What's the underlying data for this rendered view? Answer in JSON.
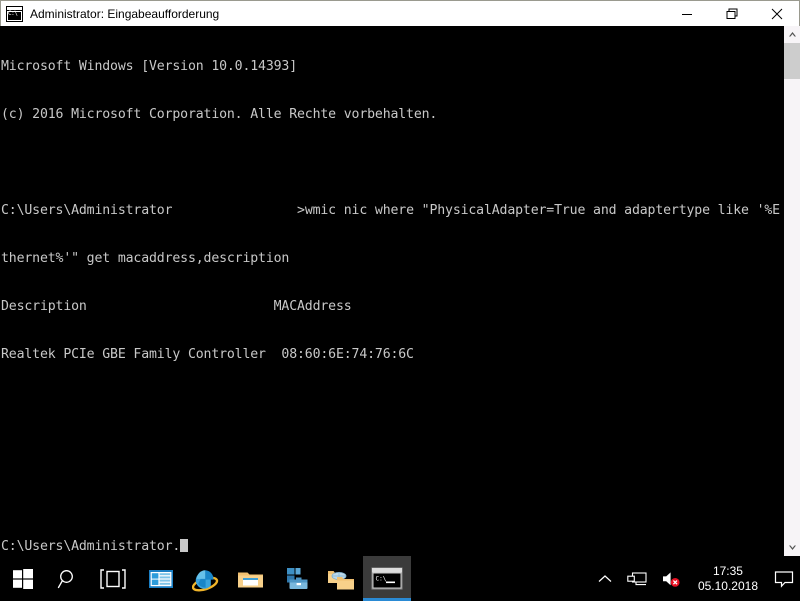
{
  "window": {
    "title": "Administrator: Eingabeaufforderung",
    "icon": "cmd-icon",
    "icon_text": "C:\\",
    "controls": {
      "minimize_label": "Minimieren",
      "restore_label": "Wiederherstellen",
      "close_label": "Schließen"
    }
  },
  "console": {
    "background": "#000000",
    "foreground": "#c8c8c8",
    "lines": [
      "Microsoft Windows [Version 10.0.14393]",
      "(c) 2016 Microsoft Corporation. Alle Rechte vorbehalten.",
      "",
      "",
      "Description                        MACAddress",
      "Realtek PCIe GBE Family Controller  08:60:6E:74:76:6C",
      "",
      "",
      ""
    ],
    "prompt_line": {
      "path": "C:\\Users\\Administrator",
      "redacted": "                ",
      "chevron": ">",
      "command": "wmic nic where \"PhysicalAdapter=True and adaptertype like '%E"
    },
    "command_wrap": "thernet%'\" get macaddress,description",
    "final_prompt": {
      "path": "C:\\Users\\Administrator.",
      "cursor": "_"
    }
  },
  "scrollbar": {
    "up_arrow": "scroll-up-arrow",
    "down_arrow": "scroll-down-arrow",
    "thumb_position_percent": 0
  },
  "taskbar": {
    "start": {
      "label": "Start",
      "icon": "windows-logo-icon"
    },
    "search": {
      "label": "Suchen",
      "icon": "search-icon"
    },
    "taskview": {
      "label": "Taskansicht",
      "icon": "task-view-icon"
    },
    "apps": [
      {
        "label": "Server-Manager",
        "icon": "server-manager-icon",
        "active": false
      },
      {
        "label": "Internet Explorer",
        "icon": "internet-explorer-icon",
        "active": false
      },
      {
        "label": "Explorer",
        "icon": "file-explorer-icon",
        "active": false
      },
      {
        "label": "Windows PowerShell ISE",
        "icon": "tools-icon",
        "active": false
      },
      {
        "label": "Netzwerkordner",
        "icon": "network-folder-icon",
        "active": false
      },
      {
        "label": "Eingabeaufforderung",
        "icon": "command-prompt-icon",
        "active": true
      }
    ],
    "tray": {
      "show_hidden": {
        "label": "Ausgeblendete Symbole einblenden",
        "icon": "chevron-up-icon"
      },
      "network": {
        "label": "Netzwerk",
        "icon": "network-icon"
      },
      "volume": {
        "label": "Lautsprecher stummgeschaltet",
        "icon": "volume-muted-icon",
        "badge_color": "#e81123"
      },
      "clock": {
        "time": "17:35",
        "date": "05.10.2018"
      },
      "action_center": {
        "label": "Info-Center",
        "icon": "notification-icon"
      }
    }
  }
}
